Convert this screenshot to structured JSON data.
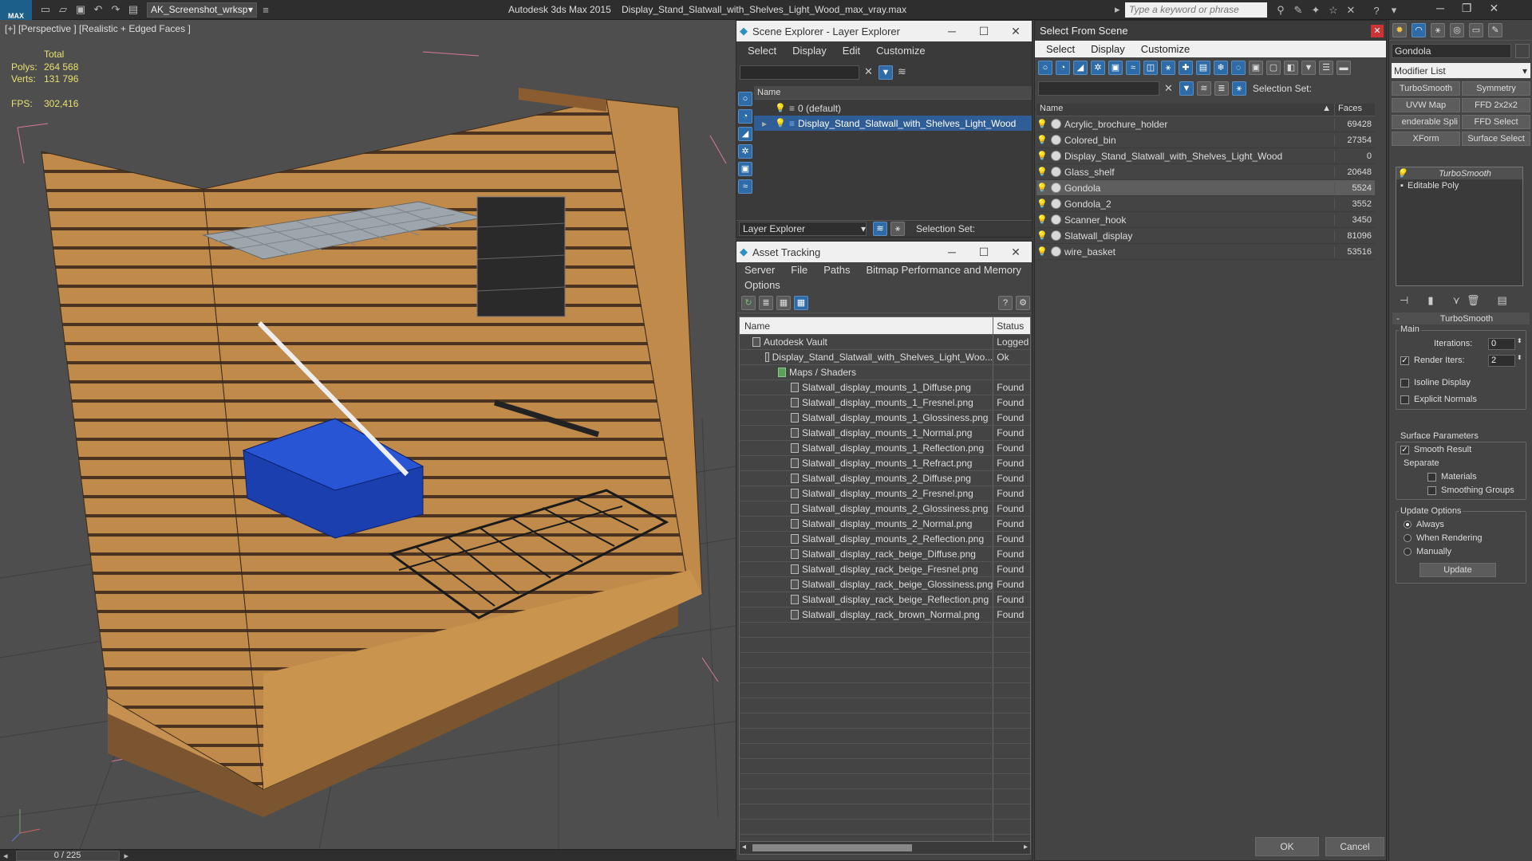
{
  "titlebar": {
    "app_logo": "MAX",
    "workspace": "AK_Screenshot_wrksp",
    "app_name": "Autodesk 3ds Max  2015",
    "file_name": "Display_Stand_Slatwall_with_Shelves_Light_Wood_max_vray.max",
    "search_placeholder": "Type a keyword or phrase"
  },
  "viewport": {
    "label": "[+] [Perspective ] [Realistic + Edged Faces ]",
    "total_label": "Total",
    "polys_label": "Polys:",
    "polys_value": "264 568",
    "verts_label": "Verts:",
    "verts_value": "131 796",
    "fps_label": "FPS:",
    "fps_value": "302,416"
  },
  "timeline": {
    "frame": "0 / 225"
  },
  "scene_explorer": {
    "title": "Scene Explorer - Layer Explorer",
    "menu": [
      "Select",
      "Display",
      "Edit",
      "Customize"
    ],
    "column": "Name",
    "layers": [
      "0 (default)",
      "Display_Stand_Slatwall_with_Shelves_Light_Wood"
    ],
    "footer_label": "Layer Explorer",
    "selection_set": "Selection Set:"
  },
  "asset_tracking": {
    "title": "Asset Tracking",
    "menu": [
      "Server",
      "File",
      "Paths",
      "Bitmap Performance and Memory"
    ],
    "menu2": "Options",
    "col_name": "Name",
    "col_status": "Status",
    "rows": [
      {
        "name": "Autodesk Vault",
        "status": "Logged",
        "indent": 1
      },
      {
        "name": "Display_Stand_Slatwall_with_Shelves_Light_Woo...",
        "status": "Ok",
        "indent": 2
      },
      {
        "name": "Maps / Shaders",
        "status": "",
        "indent": 3
      },
      {
        "name": "Slatwall_display_mounts_1_Diffuse.png",
        "status": "Found",
        "indent": 4
      },
      {
        "name": "Slatwall_display_mounts_1_Fresnel.png",
        "status": "Found",
        "indent": 4
      },
      {
        "name": "Slatwall_display_mounts_1_Glossiness.png",
        "status": "Found",
        "indent": 4
      },
      {
        "name": "Slatwall_display_mounts_1_Normal.png",
        "status": "Found",
        "indent": 4
      },
      {
        "name": "Slatwall_display_mounts_1_Reflection.png",
        "status": "Found",
        "indent": 4
      },
      {
        "name": "Slatwall_display_mounts_1_Refract.png",
        "status": "Found",
        "indent": 4
      },
      {
        "name": "Slatwall_display_mounts_2_Diffuse.png",
        "status": "Found",
        "indent": 4
      },
      {
        "name": "Slatwall_display_mounts_2_Fresnel.png",
        "status": "Found",
        "indent": 4
      },
      {
        "name": "Slatwall_display_mounts_2_Glossiness.png",
        "status": "Found",
        "indent": 4
      },
      {
        "name": "Slatwall_display_mounts_2_Normal.png",
        "status": "Found",
        "indent": 4
      },
      {
        "name": "Slatwall_display_mounts_2_Reflection.png",
        "status": "Found",
        "indent": 4
      },
      {
        "name": "Slatwall_display_rack_beige_Diffuse.png",
        "status": "Found",
        "indent": 4
      },
      {
        "name": "Slatwall_display_rack_beige_Fresnel.png",
        "status": "Found",
        "indent": 4
      },
      {
        "name": "Slatwall_display_rack_beige_Glossiness.png",
        "status": "Found",
        "indent": 4
      },
      {
        "name": "Slatwall_display_rack_beige_Reflection.png",
        "status": "Found",
        "indent": 4
      },
      {
        "name": "Slatwall_display_rack_brown_Normal.png",
        "status": "Found",
        "indent": 4
      }
    ]
  },
  "select_from_scene": {
    "title": "Select From Scene",
    "menu": [
      "Select",
      "Display",
      "Customize"
    ],
    "selection_set": "Selection Set:",
    "col_name": "Name",
    "col_faces": "Faces",
    "objects": [
      {
        "name": "Acrylic_brochure_holder",
        "faces": "69428"
      },
      {
        "name": "Colored_bin",
        "faces": "27354"
      },
      {
        "name": "Display_Stand_Slatwall_with_Shelves_Light_Wood",
        "faces": "0"
      },
      {
        "name": "Glass_shelf",
        "faces": "20648"
      },
      {
        "name": "Gondola",
        "faces": "5524"
      },
      {
        "name": "Gondola_2",
        "faces": "3552"
      },
      {
        "name": "Scanner_hook",
        "faces": "3450"
      },
      {
        "name": "Slatwall_display",
        "faces": "81096"
      },
      {
        "name": "wire_basket",
        "faces": "53516"
      }
    ],
    "ok": "OK",
    "cancel": "Cancel"
  },
  "command_panel": {
    "object_name": "Gondola",
    "modifier_list": "Modifier List",
    "modifier_buttons": [
      "TurboSmooth",
      "Symmetry",
      "UVW Map",
      "FFD 2x2x2",
      "enderable Spli",
      "FFD Select",
      "XForm",
      "Surface Select"
    ],
    "stack": [
      "TurboSmooth",
      "Editable Poly"
    ],
    "rollout_title": "TurboSmooth",
    "main_label": "Main",
    "iterations_label": "Iterations:",
    "iterations_value": "0",
    "render_iters_label": "Render Iters:",
    "render_iters_value": "2",
    "isoline": "Isoline Display",
    "explicit_normals": "Explicit Normals",
    "surface_params": "Surface Parameters",
    "smooth_result": "Smooth Result",
    "separate": "Separate",
    "materials": "Materials",
    "smoothing_groups": "Smoothing Groups",
    "update_options": "Update Options",
    "always": "Always",
    "when_rendering": "When Rendering",
    "manually": "Manually",
    "update": "Update"
  }
}
